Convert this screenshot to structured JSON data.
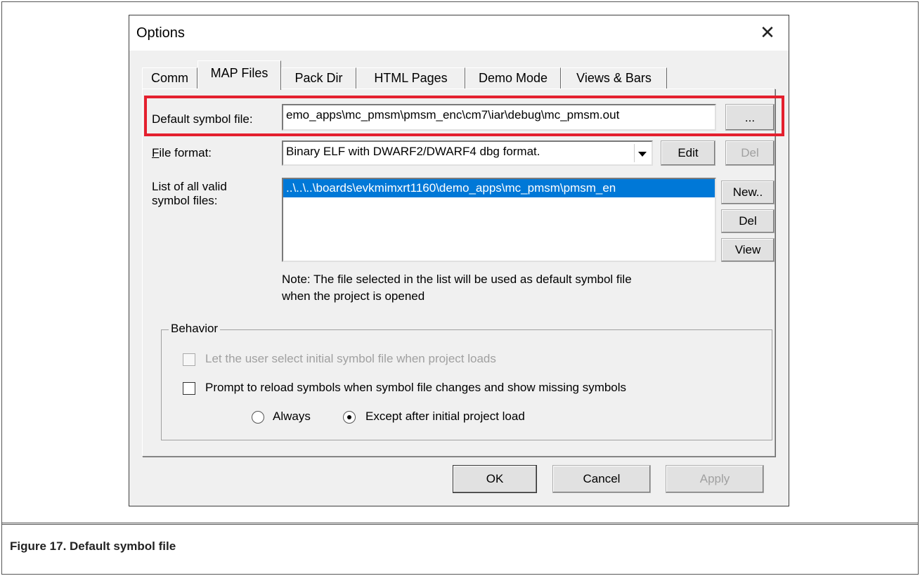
{
  "dialog": {
    "title": "Options",
    "close_glyph": "✕"
  },
  "tabs": [
    {
      "label": "Comm"
    },
    {
      "label": "MAP Files"
    },
    {
      "label": "Pack Dir"
    },
    {
      "label": "HTML Pages"
    },
    {
      "label": "Demo Mode"
    },
    {
      "label": "Views & Bars"
    }
  ],
  "map_files": {
    "default_symbol_label": "Default symbol file:",
    "default_symbol_value": "emo_apps\\mc_pmsm\\pmsm_enc\\cm7\\iar\\debug\\mc_pmsm.out",
    "browse_label": "...",
    "file_format_label": "File format:",
    "file_format_value": "Binary ELF with DWARF2/DWARF4 dbg format.",
    "edit_label": "Edit",
    "del_format_label": "Del",
    "list_label_1": "List of all valid",
    "list_label_2": "symbol files:",
    "list_items": [
      "..\\..\\..\\boards\\evkmimxrt1160\\demo_apps\\mc_pmsm\\pmsm_en"
    ],
    "new_label": "New..",
    "del_label": "Del",
    "view_label": "View",
    "note_line_1": "Note: The file selected in the list will be used as default symbol file",
    "note_line_2": "when the project is opened"
  },
  "behavior": {
    "title": "Behavior",
    "let_user_select": "Let the user select initial symbol file when project loads",
    "prompt_reload": "Prompt to reload symbols when symbol file changes and show missing symbols",
    "always": "Always",
    "except_after": "Except after initial project load"
  },
  "footer": {
    "ok": "OK",
    "cancel": "Cancel",
    "apply": "Apply"
  },
  "caption": "Figure 17. Default symbol file",
  "colors": {
    "highlight": "#e4202e",
    "selection": "#0078d7"
  }
}
